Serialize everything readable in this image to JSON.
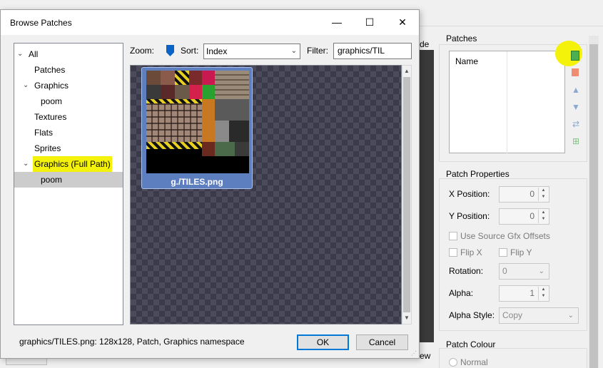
{
  "background": {
    "fragment_top": "de",
    "fragment_bottom": "ew"
  },
  "right_panel": {
    "patches_title": "Patches",
    "patches_column": "Name",
    "props_title": "Patch Properties",
    "x_label": "X Position:",
    "x_value": "0",
    "y_label": "Y Position:",
    "y_value": "0",
    "use_source_offsets": "Use Source Gfx Offsets",
    "flip_x": "Flip X",
    "flip_y": "Flip Y",
    "rotation_label": "Rotation:",
    "rotation_value": "0",
    "alpha_label": "Alpha:",
    "alpha_value": "1",
    "alpha_style_label": "Alpha Style:",
    "alpha_style_value": "Copy",
    "colour_title": "Patch Colour",
    "colour_normal": "Normal"
  },
  "dialog": {
    "title": "Browse Patches",
    "tree": [
      {
        "label": "All",
        "expanded": true
      },
      {
        "label": "Patches"
      },
      {
        "label": "Graphics",
        "expanded": true
      },
      {
        "label": "poom"
      },
      {
        "label": "Textures"
      },
      {
        "label": "Flats"
      },
      {
        "label": "Sprites"
      },
      {
        "label": "Graphics (Full Path)",
        "expanded": true,
        "highlighted": true
      },
      {
        "label": "poom",
        "selected": true
      }
    ],
    "zoom_label": "Zoom:",
    "sort_label": "Sort:",
    "sort_value": "Index",
    "filter_label": "Filter:",
    "filter_value": "graphics/TIL",
    "item_caption": "g./TILES.png",
    "status": "graphics/TILES.png: 128x128, Patch, Graphics namespace",
    "ok_label": "OK",
    "cancel_label": "Cancel"
  },
  "icons": {
    "minimize": "minimize-icon",
    "maximize": "maximize-icon",
    "close": "close-icon"
  },
  "colors": {
    "highlight": "#f4f20a",
    "selection": "#5d7ebf",
    "accent": "#0078d7"
  }
}
